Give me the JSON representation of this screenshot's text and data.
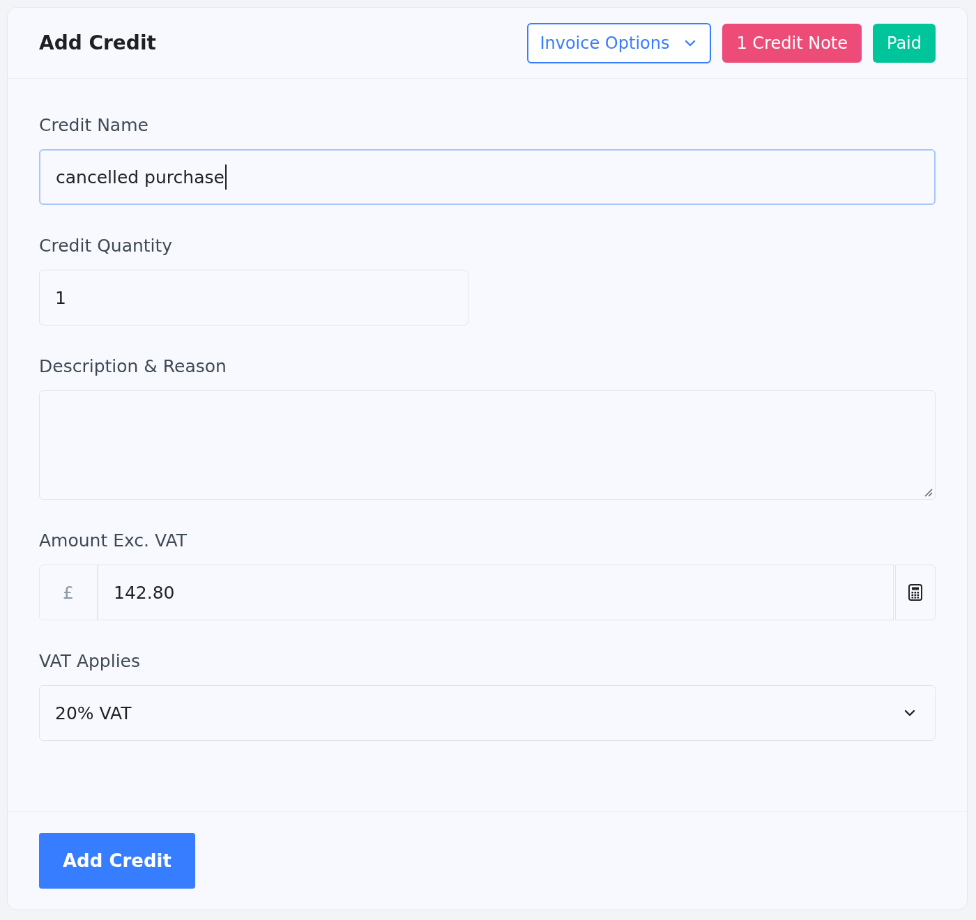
{
  "header": {
    "title": "Add Credit",
    "options_button": {
      "label": "Invoice Options"
    },
    "badges": [
      {
        "label": "1 Credit Note",
        "color": "#ed4c78"
      },
      {
        "label": "Paid",
        "color": "#00c49a"
      }
    ]
  },
  "fields": [
    {
      "kind": "text",
      "label": "Credit Name",
      "value": "cancelled purchase",
      "focused": true
    },
    {
      "kind": "number",
      "label": "Credit Quantity",
      "value": "1",
      "focused": false
    },
    {
      "kind": "textarea",
      "label": "Description & Reason",
      "focused": false
    },
    {
      "kind": "money",
      "label": "Amount Exc. VAT",
      "prefix": "£",
      "value": "142.80",
      "focused": false
    },
    {
      "kind": "select",
      "label": "VAT Applies",
      "value": "20% VAT",
      "focused": false
    }
  ],
  "submit": {
    "label": "Add Credit"
  }
}
